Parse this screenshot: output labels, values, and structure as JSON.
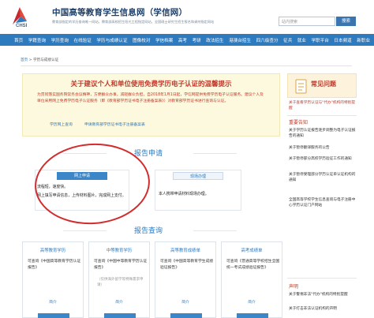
{
  "header": {
    "logo_text": "CHSI",
    "title": "中国高等教育学生信息网（学信网）",
    "subtitle": "教育部指定的学历查询唯一网站，教育部高校招生阳光工程指定网站，全国硕士研究生招生报名和调剂指定网站",
    "search_placeholder": "站内搜索",
    "search_button": "搜索"
  },
  "nav": {
    "items": [
      "首页",
      "学籍查询",
      "学历查询",
      "在线验证",
      "学历与成绩认证",
      "图像校对",
      "学信档案",
      "高考",
      "考研",
      "政法招生",
      "港澳台招生",
      "四六级查分",
      "征兵",
      "就业",
      "学职平台",
      "日本频道",
      "新职业"
    ]
  },
  "breadcrumb": {
    "home": "首页",
    "sep": ">",
    "current": "学历与成绩认证"
  },
  "notice": {
    "title": "关于建议个人和单位使用免费学历电子认证的温馨提示",
    "body": "为贯彻落实国务院常务会议精神，方便群众办事，减轻群众负担，自2018年1月1日起，学信网提供免费学历电子认证服务。建议个人及单位采用网上免费学历电子认证服务（即《教育部学历证书电子注册备案表》）对教育部学历证书进行查询与认证。",
    "link1": "学历网上查询",
    "link2": "申请教育部学历证书电子注册备案表"
  },
  "report_apply": {
    "title": "报告申请",
    "online": {
      "label": "网上申请",
      "line1": "流程短，速度快。",
      "line2": "网上填写申请信息，上传材料图片，完成网上支付。"
    },
    "onsite": {
      "label": "现场办理",
      "line1": "本人携带申请材料现场办理。"
    }
  },
  "report_query": {
    "title": "报告查询",
    "cards": [
      {
        "title": "高等教育学历",
        "desc": "可查询《中国高等教育学历认证报告》",
        "note": "",
        "link": "简介"
      },
      {
        "title": "中等教育学历",
        "desc": "可查询《中国中等教育学历认证报告》",
        "note": "（仅供海外留学等特殊需求申请）",
        "link": "简介"
      },
      {
        "title": "高等教育成绩单",
        "desc": "可查询《中国高等教育学生成绩验证报告》",
        "note": "",
        "link": "简介"
      },
      {
        "title": "高考成绩单",
        "desc": "可查询《普通高等学校招生全国统一考试成绩验证报告》",
        "note": "",
        "link": "简介"
      }
    ]
  },
  "sidebar": {
    "faq_title": "常见问题",
    "faq_item": "关于查看学历认证与\"代办\"机构的特别提醒",
    "notice_head": "重要告知",
    "notices": [
      "关于学历认证报告逐步调整为电子认证报告的通知",
      "关于暂停翻译服务的公告",
      "关于暂停部分高校学历验证工作的通知",
      "关于暂停受理部分学历认证单认证机构的通知",
      "全国高等学校学生信息查询与电子注册中心学历认证门户网站"
    ],
    "statement_head": "声明",
    "statements": [
      "关于警惕非法\"代办\"机构的特别提醒",
      "关于打击非法认证机构的声明"
    ]
  },
  "colors": {
    "nav": "#2e7abf",
    "accent_red": "#c0392b",
    "notice_bg": "#fdf9df",
    "annotation": "#d32c2c"
  }
}
